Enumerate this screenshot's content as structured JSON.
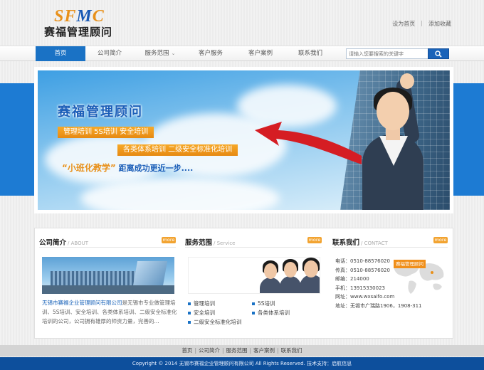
{
  "header": {
    "logo_en_part1": "SF",
    "logo_en_part2": "M",
    "logo_en_part3": "C",
    "logo_cn": "赛福管理顾问",
    "links": [
      "设为首页",
      "添加收藏"
    ]
  },
  "nav": {
    "items": [
      "首页",
      "公司简介",
      "服务范围",
      "客户服务",
      "客户案例",
      "联系我们"
    ],
    "active_index": 0,
    "search_placeholder": "请输入您要搜索的关键字"
  },
  "banner": {
    "title": "赛福管理顾问",
    "tag1": "管理培训   5S培训   安全培训",
    "tag2": "各类体系培训   二级安全标准化培训",
    "slogan_hl": "“小班化教学”",
    "slogan_rest": " 距离成功更近一步...."
  },
  "about": {
    "title": "公司简介",
    "sub": "/ ABOUT",
    "more": "more",
    "company": "无锡市赛福企业管理顾问有限公司",
    "text": "是无锡市专业做管理培训、5S培训、安全培训、各类体系培训、二级安全标准化培训的公司，公司拥有雄厚的师资力量，完善的..."
  },
  "service": {
    "title": "服务范围",
    "sub": "/ Service",
    "more": "more",
    "items": [
      "管理培训",
      "5S培训",
      "安全培训",
      "各类体系培训",
      "二级安全标准化培训"
    ]
  },
  "contact": {
    "title": "联系我们",
    "sub": "/ CONTACT",
    "more": "more",
    "map_label": "赛福管理顾问",
    "rows": [
      "电话：0510-88576020",
      "传真：0510-88576020",
      "邮编：214000",
      "手机：13915330023",
      "网址：www.wxsaifo.com",
      "地址：无锡市广瑞路1906，1908-311"
    ]
  },
  "footer": {
    "links": [
      "首页",
      "公司简介",
      "服务范围",
      "客户案例",
      "联系我们"
    ],
    "copyright": "Copyright © 2014 无锡市赛福企业管理顾问有限公司  All Rights Reserved.      技术支持：启航信息"
  },
  "colors": {
    "brand_blue": "#1a72c5",
    "accent_orange": "#e8901a",
    "footer_blue": "#0d4f9c"
  }
}
